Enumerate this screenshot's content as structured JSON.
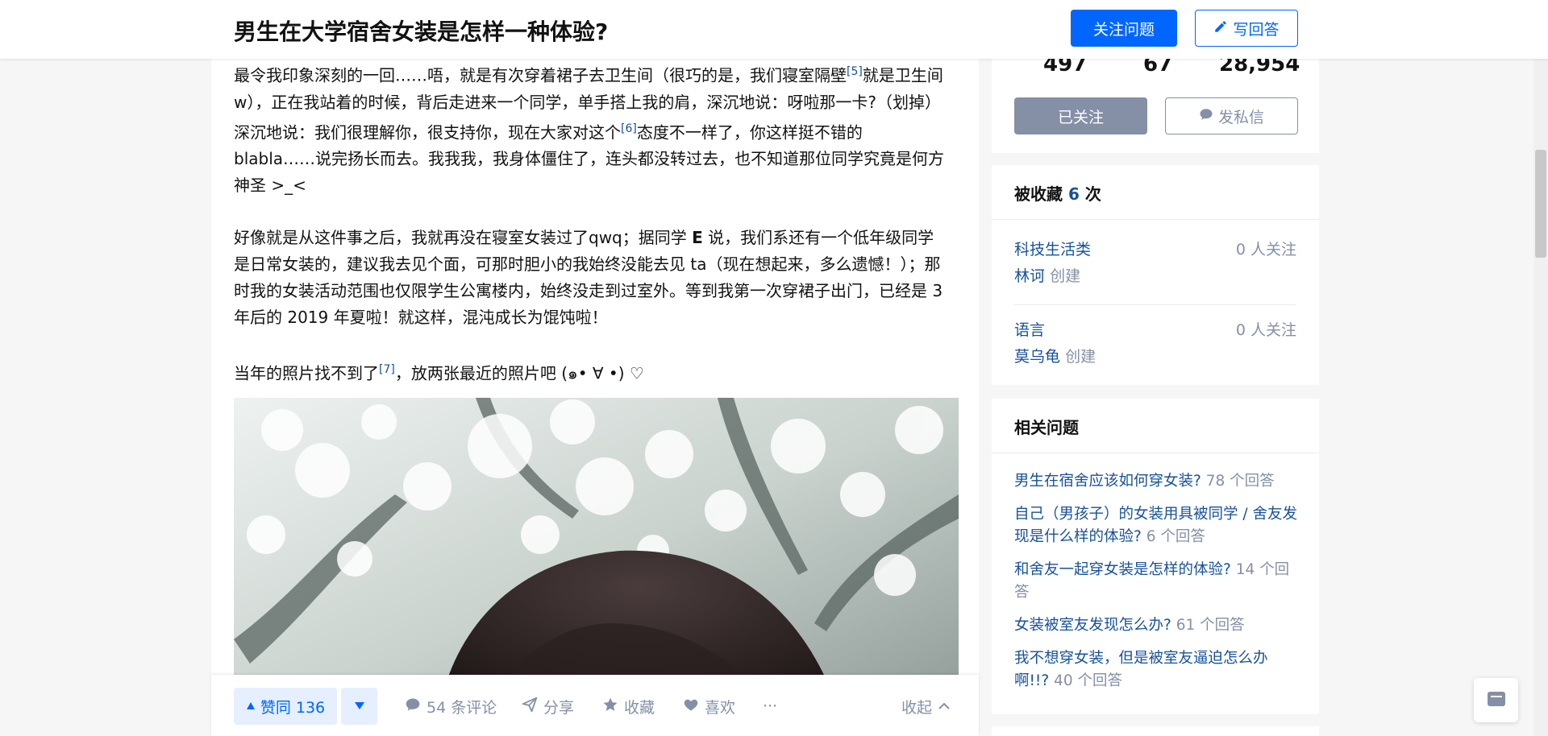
{
  "header": {
    "question_title": "男生在大学宿舍女装是怎样一种体验?",
    "follow_label": "关注问题",
    "answer_label": "写回答"
  },
  "answer": {
    "paragraphs": [
      {
        "parts": [
          {
            "text": "最令我印象深刻的一回……唔，就是有次穿着裙子去卫生间（很巧的是，我们寝室隔壁"
          },
          {
            "ref": "[5]"
          },
          {
            "text": "就是卫生间w），正在我站着的时候，背后走进来一个同学，单手搭上我的肩，深沉地说：呀啦那一卡?（划掉）深沉地说：我们很理解你，很支持你，现在大家对这个"
          },
          {
            "ref": "[6]"
          },
          {
            "text": "态度不一样了，你这样挺不错的 blabla……说完扬长而去。我我我，我身体僵住了，连头都没转过去，也不知道那位同学究竟是何方神圣 >_<"
          }
        ]
      },
      {
        "parts": [
          {
            "text": "好像就是从这件事之后，我就再没在寝室女装过了qwq；据同学 "
          },
          {
            "bold": "E"
          },
          {
            "text": " 说，我们系还有一个低年级同学是日常女装的，建议我去见个面，可那时胆小的我始终没能去见 ta（现在想起来，多么遗憾！）；那时我的女装活动范围也仅限学生公寓楼内，始终没走到过室外。等到我第一次穿裙子出门，已经是 3 年后的 2019 年夏啦！就这样，混沌成长为馄饨啦！"
          }
        ]
      },
      {
        "parts": [
          {
            "text": "当年的照片找不到了"
          },
          {
            "ref": "[7]"
          },
          {
            "text": "，放两张最近的照片吧 (๑• ∀ •) ♡"
          }
        ]
      }
    ]
  },
  "actions": {
    "upvote_label": "赞同 136",
    "comments_label": "54 条评论",
    "share_label": "分享",
    "collect_label": "收藏",
    "like_label": "喜欢",
    "more_label": "···",
    "collapse_label": "收起"
  },
  "sidebar": {
    "stats": {
      "values": [
        "497",
        "67",
        "28,954"
      ],
      "followed_label": "已关注",
      "message_label": "发私信"
    },
    "favorites": {
      "title_prefix": "被收藏 ",
      "count": "6",
      "title_suffix": " 次",
      "collections": [
        {
          "name": "科技生活类",
          "followers": "0 人关注",
          "creator": "林诃",
          "created_label": "创建"
        },
        {
          "name": "语言",
          "followers": "0 人关注",
          "creator": "莫乌龟",
          "created_label": "创建"
        }
      ]
    },
    "related": {
      "title": "相关问题",
      "items": [
        {
          "question": "男生在宿舍应该如何穿女装?",
          "count": "78 个回答"
        },
        {
          "question": "自己（男孩子）的女装用具被同学 / 舍友发现是什么样的体验?",
          "count": "6 个回答"
        },
        {
          "question": "和舍友一起穿女装是怎样的体验?",
          "count": "14 个回答"
        },
        {
          "question": "女装被室友发现怎么办?",
          "count": "61 个回答"
        },
        {
          "question": "我不想穿女装，但是被室友逼迫怎么办啊!!?",
          "count": "40 个回答"
        }
      ]
    }
  },
  "icons": {
    "pencil": "pencil-icon",
    "comment": "comment-icon",
    "share": "paper-plane-icon",
    "star": "star-icon",
    "heart": "heart-icon",
    "chevron": "chevron-up-icon",
    "floating": "inbox-icon"
  },
  "colors": {
    "brand_blue": "#0066ff",
    "link_blue": "#175199",
    "gray": "#8590a6",
    "page_bg": "#f6f6f6"
  }
}
